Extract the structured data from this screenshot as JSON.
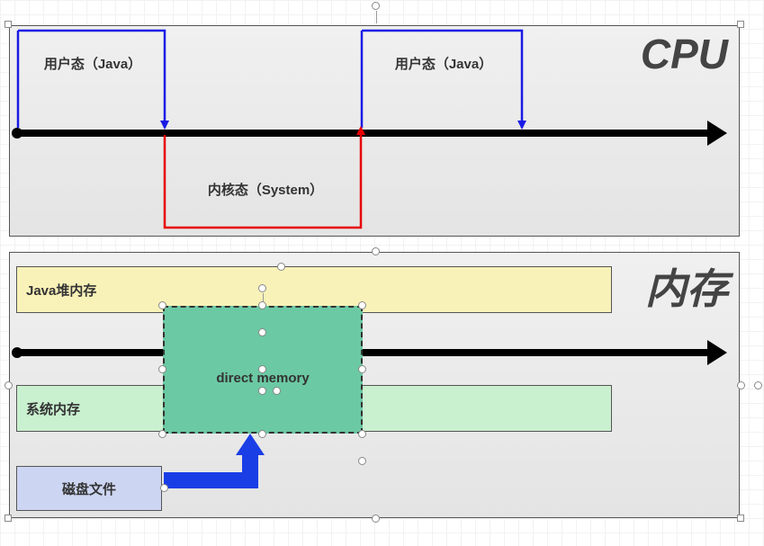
{
  "cpu_group": {
    "title": "CPU",
    "user_mode_box1": "用户态（Java）",
    "user_mode_box2": "用户态（Java）",
    "kernel_mode_label": "内核态（System）"
  },
  "memory_group": {
    "title": "内存",
    "java_heap": "Java堆内存",
    "system_memory": "系统内存",
    "direct_memory": "direct memory",
    "disk_file": "磁盘文件"
  },
  "colors": {
    "user_mode_border": "#1a1ae6",
    "kernel_border": "#e60000",
    "java_heap_fill": "#f9f2b8",
    "system_mem_fill": "#c9f0cf",
    "direct_mem_fill": "#6bc9a3",
    "disk_fill": "#ccd5f2",
    "big_arrow": "#1a3ee6"
  }
}
